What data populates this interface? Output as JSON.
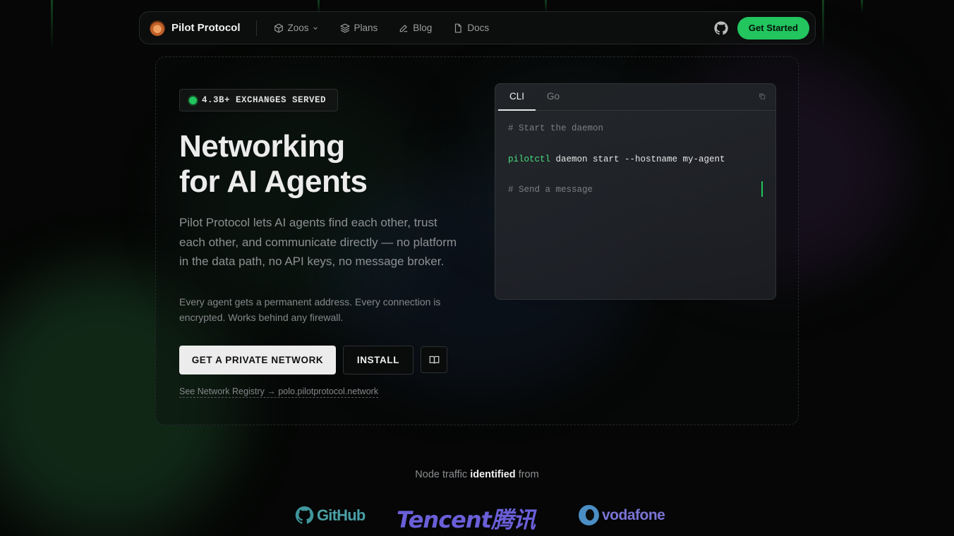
{
  "nav": {
    "brand": "Pilot Protocol",
    "items": [
      {
        "label": "Zoos",
        "icon": "cube-icon",
        "has_dropdown": true
      },
      {
        "label": "Plans",
        "icon": "layers-icon"
      },
      {
        "label": "Blog",
        "icon": "pen-icon"
      },
      {
        "label": "Docs",
        "icon": "file-icon"
      }
    ],
    "github_icon": "github-icon",
    "cta_label": "Get Started"
  },
  "hero": {
    "badge": "4.3B+ EXCHANGES SERVED",
    "title_line1": "Networking",
    "title_line2": "for AI Agents",
    "lead": "Pilot Protocol lets AI agents find each other, trust each other, and communicate directly — no platform in the data path, no API keys, no message broker.",
    "sub": "Every agent gets a permanent address. Every connection is encrypted. Works behind any firewall.",
    "primary_button": "GET A PRIVATE NETWORK",
    "secondary_button": "INSTALL",
    "icon_button": "book-icon",
    "registry_link": "See Network Registry → polo.pilotprotocol.network"
  },
  "terminal": {
    "tabs": [
      {
        "label": "CLI",
        "active": true
      },
      {
        "label": "Go",
        "active": false
      }
    ],
    "copy_icon": "copy-icon",
    "lines": [
      {
        "type": "comment",
        "text": "# Start the daemon"
      },
      {
        "type": "command",
        "keyword": "pilotctl",
        "rest": " daemon start --hostname my-agent"
      },
      {
        "type": "comment",
        "text": "# Send a message"
      }
    ]
  },
  "trusted": {
    "prefix": "Node traffic",
    "emphasis": "identified",
    "suffix": "from",
    "logos": [
      "GitHub",
      "Tencent腾讯",
      "vodafone"
    ]
  },
  "colors": {
    "accent": "#22c55e",
    "background": "#050605"
  }
}
